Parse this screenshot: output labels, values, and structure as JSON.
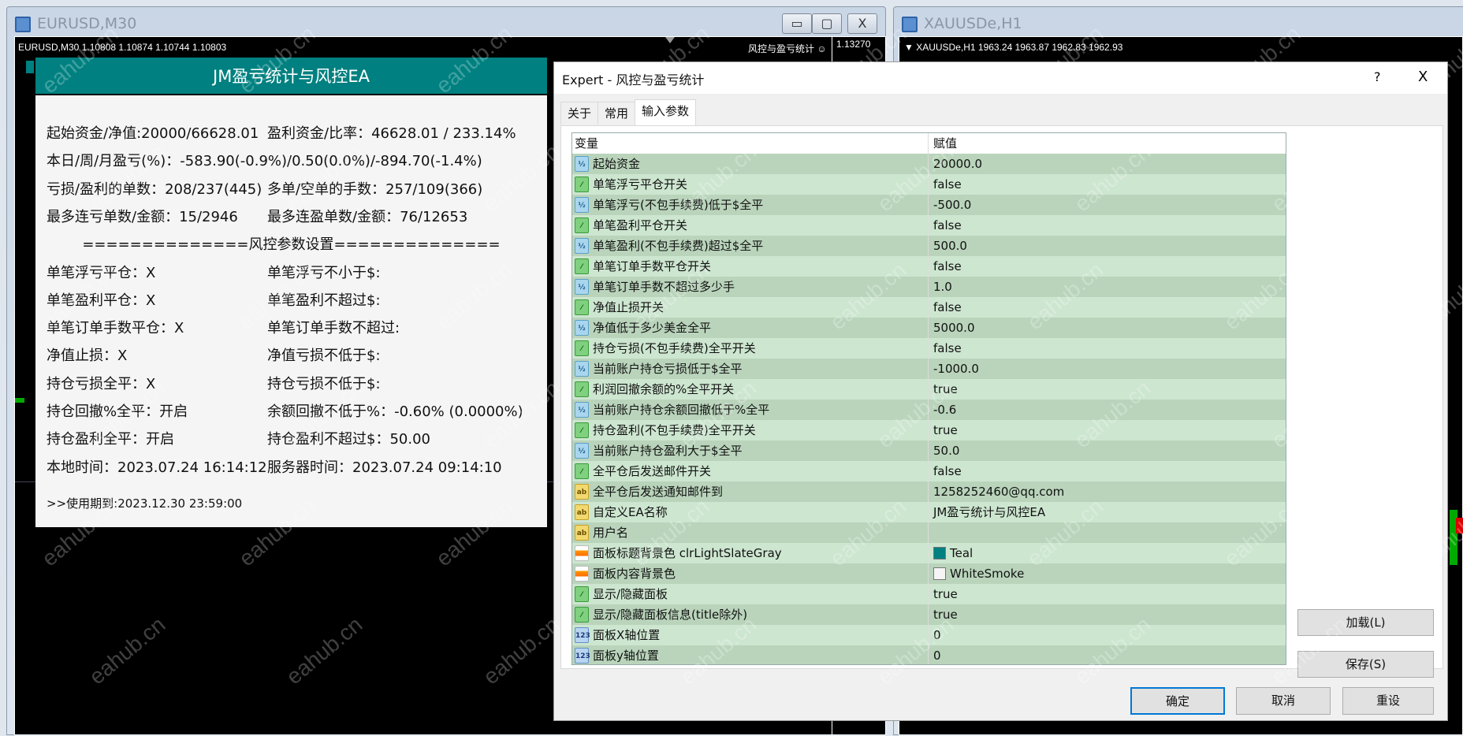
{
  "left_window": {
    "title": "EURUSD,M30",
    "chart_info": "EURUSD,M30  1.10808 1.10874 1.10744 1.10803",
    "ea_label": "风控与盈亏统计 ☺",
    "price": "1.13270",
    "btn_min": "▭",
    "btn_max": "▢",
    "btn_close": "X"
  },
  "right_window": {
    "title": "XAUUSDe,H1",
    "chart_info": "▼ XAUUSDe,H1  1963.24 1963.87 1962.83 1962.93"
  },
  "panel": {
    "title": "JM盈亏统计与风控EA",
    "lines": [
      [
        "起始资金/净值:20000/66628.01",
        "盈利资金/比率：46628.01 / 233.14%"
      ],
      [
        "本日/周/月盈亏(%)：-583.90(-0.9%)/0.50(0.0%)/-894.70(-1.4%)",
        ""
      ],
      [
        "亏损/盈利的单数：208/237(445)",
        "多单/空单的手数：257/109(366)"
      ],
      [
        "最多连亏单数/金额：15/2946",
        "最多连盈单数/金额：76/12653"
      ],
      [
        "==============风控参数设置==============",
        ""
      ],
      [
        "单笔浮亏平仓：X",
        "单笔浮亏不小于$:"
      ],
      [
        "单笔盈利平仓：X",
        "单笔盈利不超过$:"
      ],
      [
        "单笔订单手数平仓：X",
        "单笔订单手数不超过:"
      ],
      [
        "净值止损：X",
        "净值亏损不低于$:"
      ],
      [
        "持仓亏损全平：X",
        "持仓亏损不低于$:"
      ],
      [
        "持仓回撤%全平：开启",
        "余额回撤不低于%：-0.60% (0.0000%)"
      ],
      [
        "持仓盈利全平：开启",
        "持仓盈利不超过$：50.00"
      ],
      [
        "本地时间：2023.07.24 16:14:12",
        "服务器时间：2023.07.24 09:14:10"
      ]
    ],
    "expiry": ">>使用期到:2023.12.30 23:59:00"
  },
  "dialog": {
    "title": "Expert - 风控与盈亏统计",
    "help": "?",
    "close": "X",
    "tabs": [
      "关于",
      "常用",
      "输入参数"
    ],
    "headers": [
      "变量",
      "赋值"
    ],
    "rows": [
      {
        "icon": "dbl",
        "name": "起始资金",
        "value": "20000.0"
      },
      {
        "icon": "bool",
        "name": "单笔浮亏平仓开关",
        "value": "false"
      },
      {
        "icon": "dbl",
        "name": "单笔浮亏(不包手续费)低于$全平",
        "value": "-500.0"
      },
      {
        "icon": "bool",
        "name": "单笔盈利平仓开关",
        "value": "false"
      },
      {
        "icon": "dbl",
        "name": "单笔盈利(不包手续费)超过$全平",
        "value": "500.0"
      },
      {
        "icon": "bool",
        "name": "单笔订单手数平仓开关",
        "value": "false"
      },
      {
        "icon": "dbl",
        "name": "单笔订单手数不超过多少手",
        "value": "1.0"
      },
      {
        "icon": "bool",
        "name": "净值止损开关",
        "value": "false"
      },
      {
        "icon": "dbl",
        "name": "净值低于多少美金全平",
        "value": "5000.0"
      },
      {
        "icon": "bool",
        "name": "持仓亏损(不包手续费)全平开关",
        "value": "false"
      },
      {
        "icon": "dbl",
        "name": "当前账户持仓亏损低于$全平",
        "value": "-1000.0"
      },
      {
        "icon": "bool",
        "name": "利润回撤余额的%全平开关",
        "value": "true"
      },
      {
        "icon": "dbl",
        "name": "当前账户持仓余额回撤低于%全平",
        "value": "-0.6"
      },
      {
        "icon": "bool",
        "name": "持仓盈利(不包手续费)全平开关",
        "value": "true"
      },
      {
        "icon": "dbl",
        "name": "当前账户持仓盈利大于$全平",
        "value": "50.0"
      },
      {
        "icon": "bool",
        "name": "全平仓后发送邮件开关",
        "value": "false"
      },
      {
        "icon": "str",
        "name": "全平仓后发送通知邮件到",
        "value": "1258252460@qq.com"
      },
      {
        "icon": "str",
        "name": "自定义EA名称",
        "value": "JM盈亏统计与风控EA"
      },
      {
        "icon": "str",
        "name": "用户名",
        "value": ""
      },
      {
        "icon": "color",
        "name": "面板标题背景色 clrLightSlateGray",
        "value": "Teal",
        "swatch": "#008080"
      },
      {
        "icon": "color",
        "name": "面板内容背景色",
        "value": "WhiteSmoke",
        "swatch": "#f5f5f5"
      },
      {
        "icon": "bool",
        "name": "显示/隐藏面板",
        "value": "true"
      },
      {
        "icon": "bool",
        "name": "显示/隐藏面板信息(title除外)",
        "value": "true"
      },
      {
        "icon": "int",
        "name": "面板X轴位置",
        "value": "0"
      },
      {
        "icon": "int",
        "name": "面板y轴位置",
        "value": "0"
      }
    ],
    "icon_text": {
      "dbl": "½",
      "bool": "⁄",
      "str": "ab",
      "color": "",
      "int": "123"
    },
    "buttons": {
      "load": "加载(L)",
      "save": "保存(S)",
      "ok": "确定",
      "cancel": "取消",
      "reset": "重设"
    }
  },
  "watermark": "eahub.cn"
}
